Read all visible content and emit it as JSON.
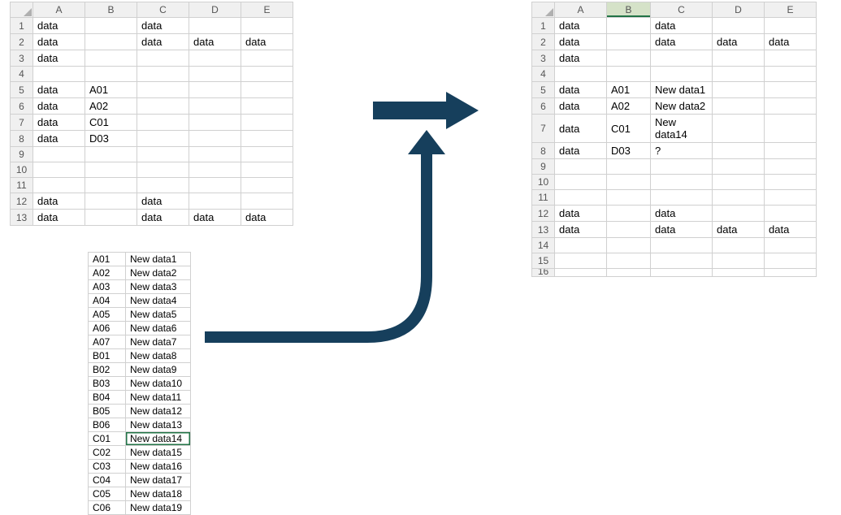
{
  "columns": [
    "A",
    "B",
    "C",
    "D",
    "E"
  ],
  "source_sheet": {
    "rows": [
      {
        "n": "1",
        "A": "data",
        "B": "",
        "C": "data",
        "D": "",
        "E": ""
      },
      {
        "n": "2",
        "A": "data",
        "B": "",
        "C": "data",
        "D": "data",
        "E": "data"
      },
      {
        "n": "3",
        "A": "data",
        "B": "",
        "C": "",
        "D": "",
        "E": ""
      },
      {
        "n": "4",
        "A": "",
        "B": "",
        "C": "",
        "D": "",
        "E": ""
      },
      {
        "n": "5",
        "A": "data",
        "B": "A01",
        "C": "",
        "D": "",
        "E": ""
      },
      {
        "n": "6",
        "A": "data",
        "B": "A02",
        "C": "",
        "D": "",
        "E": ""
      },
      {
        "n": "7",
        "A": "data",
        "B": "C01",
        "C": "",
        "D": "",
        "E": ""
      },
      {
        "n": "8",
        "A": "data",
        "B": "D03",
        "C": "",
        "D": "",
        "E": ""
      },
      {
        "n": "9",
        "A": "",
        "B": "",
        "C": "",
        "D": "",
        "E": ""
      },
      {
        "n": "10",
        "A": "",
        "B": "",
        "C": "",
        "D": "",
        "E": ""
      },
      {
        "n": "11",
        "A": "",
        "B": "",
        "C": "",
        "D": "",
        "E": ""
      },
      {
        "n": "12",
        "A": "data",
        "B": "",
        "C": "data",
        "D": "",
        "E": ""
      },
      {
        "n": "13",
        "A": "data",
        "B": "",
        "C": "data",
        "D": "data",
        "E": "data"
      }
    ]
  },
  "result_sheet": {
    "selected_column": "B",
    "rows": [
      {
        "n": "1",
        "A": "data",
        "B": "",
        "C": "data",
        "D": "",
        "E": ""
      },
      {
        "n": "2",
        "A": "data",
        "B": "",
        "C": "data",
        "D": "data",
        "E": "data"
      },
      {
        "n": "3",
        "A": "data",
        "B": "",
        "C": "",
        "D": "",
        "E": ""
      },
      {
        "n": "4",
        "A": "",
        "B": "",
        "C": "",
        "D": "",
        "E": ""
      },
      {
        "n": "5",
        "A": "data",
        "B": "A01",
        "C": "New data1",
        "D": "",
        "E": ""
      },
      {
        "n": "6",
        "A": "data",
        "B": "A02",
        "C": "New data2",
        "D": "",
        "E": ""
      },
      {
        "n": "7",
        "A": "data",
        "B": "C01",
        "C": "New data14",
        "D": "",
        "E": ""
      },
      {
        "n": "8",
        "A": "data",
        "B": "D03",
        "C": "?",
        "D": "",
        "E": ""
      },
      {
        "n": "9",
        "A": "",
        "B": "",
        "C": "",
        "D": "",
        "E": ""
      },
      {
        "n": "10",
        "A": "",
        "B": "",
        "C": "",
        "D": "",
        "E": ""
      },
      {
        "n": "11",
        "A": "",
        "B": "",
        "C": "",
        "D": "",
        "E": ""
      },
      {
        "n": "12",
        "A": "data",
        "B": "",
        "C": "data",
        "D": "",
        "E": ""
      },
      {
        "n": "13",
        "A": "data",
        "B": "",
        "C": "data",
        "D": "data",
        "E": "data"
      },
      {
        "n": "14",
        "A": "",
        "B": "",
        "C": "",
        "D": "",
        "E": ""
      },
      {
        "n": "15",
        "A": "",
        "B": "",
        "C": "",
        "D": "",
        "E": ""
      },
      {
        "n": "16",
        "A": "",
        "B": "",
        "C": "",
        "D": "",
        "E": ""
      }
    ]
  },
  "lookup_table": {
    "highlight_key": "C01",
    "items": [
      {
        "k": "A01",
        "v": "New data1"
      },
      {
        "k": "A02",
        "v": "New data2"
      },
      {
        "k": "A03",
        "v": "New data3"
      },
      {
        "k": "A04",
        "v": "New data4"
      },
      {
        "k": "A05",
        "v": "New data5"
      },
      {
        "k": "A06",
        "v": "New data6"
      },
      {
        "k": "A07",
        "v": "New data7"
      },
      {
        "k": "B01",
        "v": "New data8"
      },
      {
        "k": "B02",
        "v": "New data9"
      },
      {
        "k": "B03",
        "v": "New data10"
      },
      {
        "k": "B04",
        "v": "New data11"
      },
      {
        "k": "B05",
        "v": "New data12"
      },
      {
        "k": "B06",
        "v": "New data13"
      },
      {
        "k": "C01",
        "v": "New data14"
      },
      {
        "k": "C02",
        "v": "New data15"
      },
      {
        "k": "C03",
        "v": "New data16"
      },
      {
        "k": "C04",
        "v": "New data17"
      },
      {
        "k": "C05",
        "v": "New data18"
      },
      {
        "k": "C06",
        "v": "New data19"
      }
    ]
  },
  "arrow_color": "#163f5c"
}
